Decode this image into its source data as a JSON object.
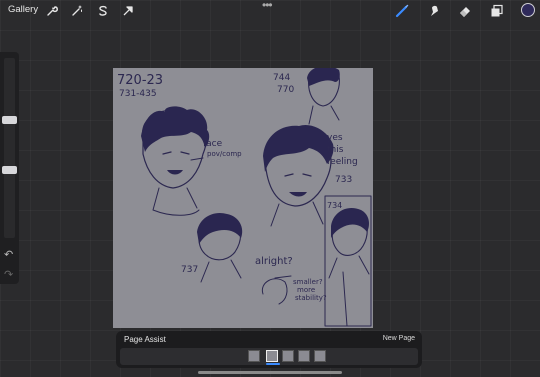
{
  "topbar": {
    "gallery_label": "Gallery",
    "left_tools": [
      "wrench-icon",
      "magic-wand-icon",
      "selection-icon",
      "transform-icon"
    ],
    "right_tools": [
      "brush-icon",
      "smudge-icon",
      "eraser-icon",
      "layers-icon"
    ],
    "current_color": "#2f2a5a"
  },
  "sidebar": {
    "tools": [
      "brush-size-slider",
      "modify-button",
      "opacity-slider",
      "undo-icon",
      "redo-icon"
    ]
  },
  "canvas": {
    "annotations": [
      "720-23",
      "731-435",
      "744",
      "770",
      "face",
      "pov/comp",
      "yes",
      "this",
      "feeling",
      "733",
      "734",
      "737",
      "alright?",
      "smaller?",
      "more",
      "stability?"
    ]
  },
  "page_assist": {
    "title": "Page Assist",
    "new_page_label": "New Page",
    "page_count": 5,
    "active_page": 2
  }
}
